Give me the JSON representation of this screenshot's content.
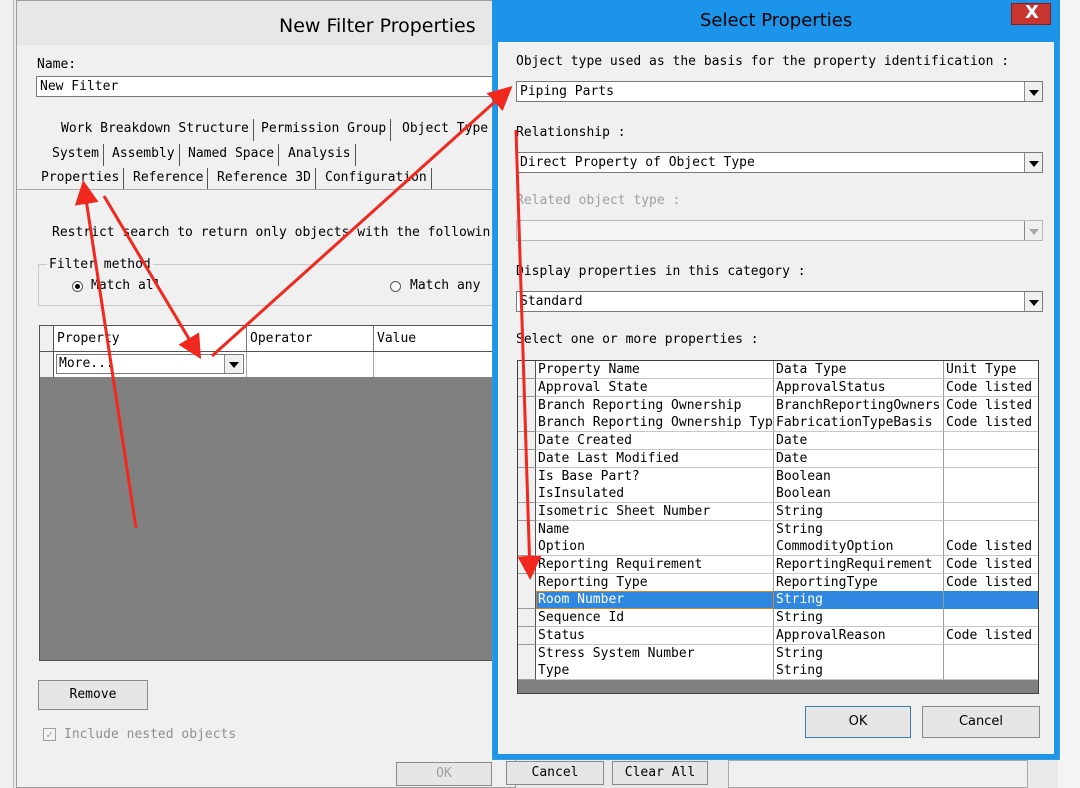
{
  "new_filter": {
    "title": "New Filter Properties",
    "name_label": "Name:",
    "name_value": "New Filter",
    "tabs_row1": [
      "Work Breakdown Structure",
      "Permission Group",
      "Object Type"
    ],
    "tabs_row2": [
      "System",
      "Assembly",
      "Named Space",
      "Analysis"
    ],
    "tabs_row3": [
      "Properties",
      "Reference",
      "Reference 3D",
      "Configuration"
    ],
    "restrict_text": "Restrict search to return only objects with the followin",
    "filter_method_label": "Filter method",
    "match_all": "Match all",
    "match_any": "Match any",
    "grid_headers": [
      "Property",
      "Operator",
      "Value"
    ],
    "grid_row_value": "More...",
    "remove_button": "Remove",
    "include_nested": "Include nested objects",
    "ok_button": "OK",
    "cancel_button": "Cancel",
    "clear_all_button": "Clear All"
  },
  "select_properties": {
    "title": "Select Properties",
    "close_glyph": "X",
    "object_type_label": "Object type used as the basis for the property identification :",
    "object_type_value": "Piping Parts",
    "relationship_label": "Relationship :",
    "relationship_value": "Direct Property of Object Type",
    "related_type_label": "Related object type :",
    "related_type_value": "",
    "category_label": "Display properties in this category :",
    "category_value": "Standard",
    "select_label": "Select one or more properties :",
    "table_headers": [
      "Property Name",
      "Data Type",
      "Unit Type"
    ],
    "rows": [
      [
        "Approval State",
        "ApprovalStatus",
        "Code listed"
      ],
      [
        "Branch Reporting Ownership",
        "BranchReportingOwners",
        "Code listed"
      ],
      [
        "Branch Reporting Ownership Typ",
        "FabricationTypeBasis",
        "Code listed"
      ],
      [
        "Date Created",
        "Date",
        ""
      ],
      [
        "Date Last Modified",
        "Date",
        ""
      ],
      [
        "Is Base Part?",
        "Boolean",
        ""
      ],
      [
        "IsInsulated",
        "Boolean",
        ""
      ],
      [
        "Isometric Sheet Number",
        "String",
        ""
      ],
      [
        "Name",
        "String",
        ""
      ],
      [
        "Option",
        "CommodityOption",
        "Code listed"
      ],
      [
        "Reporting Requirement",
        "ReportingRequirement",
        "Code listed"
      ],
      [
        "Reporting Type",
        "ReportingType",
        "Code listed"
      ],
      [
        "Room Number",
        "String",
        ""
      ],
      [
        "Sequence Id",
        "String",
        ""
      ],
      [
        "Status",
        "ApprovalReason",
        "Code listed"
      ],
      [
        "Stress System Number",
        "String",
        ""
      ],
      [
        "Type",
        "String",
        ""
      ]
    ],
    "selected_row": 12,
    "ok_button": "OK",
    "cancel_button": "Cancel"
  },
  "colors": {
    "title_bar": "#1c94e9",
    "close_button": "#c6362f",
    "selection": "#2f87e0",
    "arrow": "#f0281e"
  }
}
